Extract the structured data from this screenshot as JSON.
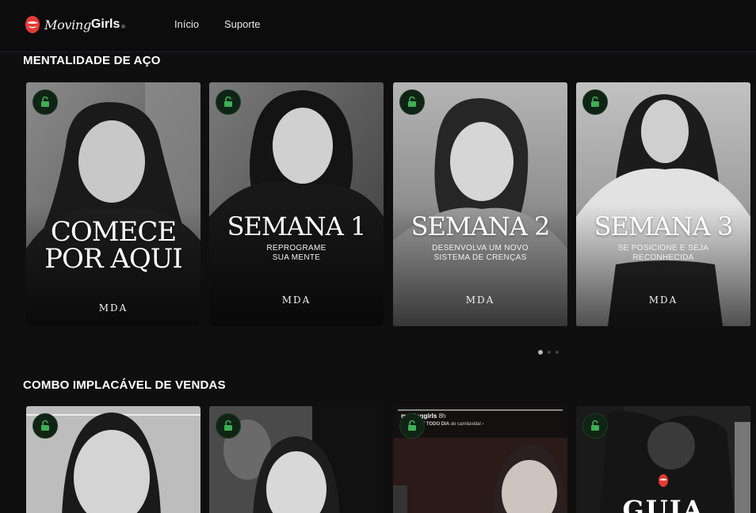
{
  "header": {
    "logo_script": "Moving",
    "logo_bold": "Girls",
    "logo_reg": "®",
    "nav": {
      "inicio": "Início",
      "suporte": "Suporte"
    }
  },
  "sections": [
    {
      "title": "MENTALIDADE DE AÇO",
      "cards": [
        {
          "title_lines": "COMECE\nPOR AQUI",
          "subtitle": "",
          "brand": "MDA"
        },
        {
          "title_lines": "SEMANA 1",
          "subtitle": "REPROGRAME\nSUA MENTE",
          "brand": "MDA"
        },
        {
          "title_lines": "SEMANA 2",
          "subtitle": "DESENVOLVA UM NOVO\nSISTEMA DE CRENÇAS",
          "brand": "MDA"
        },
        {
          "title_lines": "SEMANA 3",
          "subtitle": "SE POSICIONE E SEJA\nRECONHECIDA",
          "brand": "MDA"
        }
      ],
      "carousel": {
        "pages": 3,
        "active": 1
      }
    },
    {
      "title": "COMBO IMPLACÁVEL DE VENDAS",
      "cards": [
        {
          "title_lines": "",
          "subtitle": "",
          "brand": ""
        },
        {
          "title_lines": "",
          "subtitle": "",
          "brand": ""
        },
        {
          "story_user": "movinggirls",
          "story_time": "8h",
          "story_caption": "STORY TODO DIA",
          "story_by": "de camilavidal ›"
        },
        {
          "title_lines": "GUIA"
        }
      ]
    }
  ],
  "colors": {
    "background": "#0f0f10",
    "lock_badge": "#0f2415",
    "lock_icon": "#3fae55",
    "logo_red": "#e53935"
  },
  "icons": {
    "card_badge": "unlock-icon",
    "logo": "lips-icon"
  }
}
